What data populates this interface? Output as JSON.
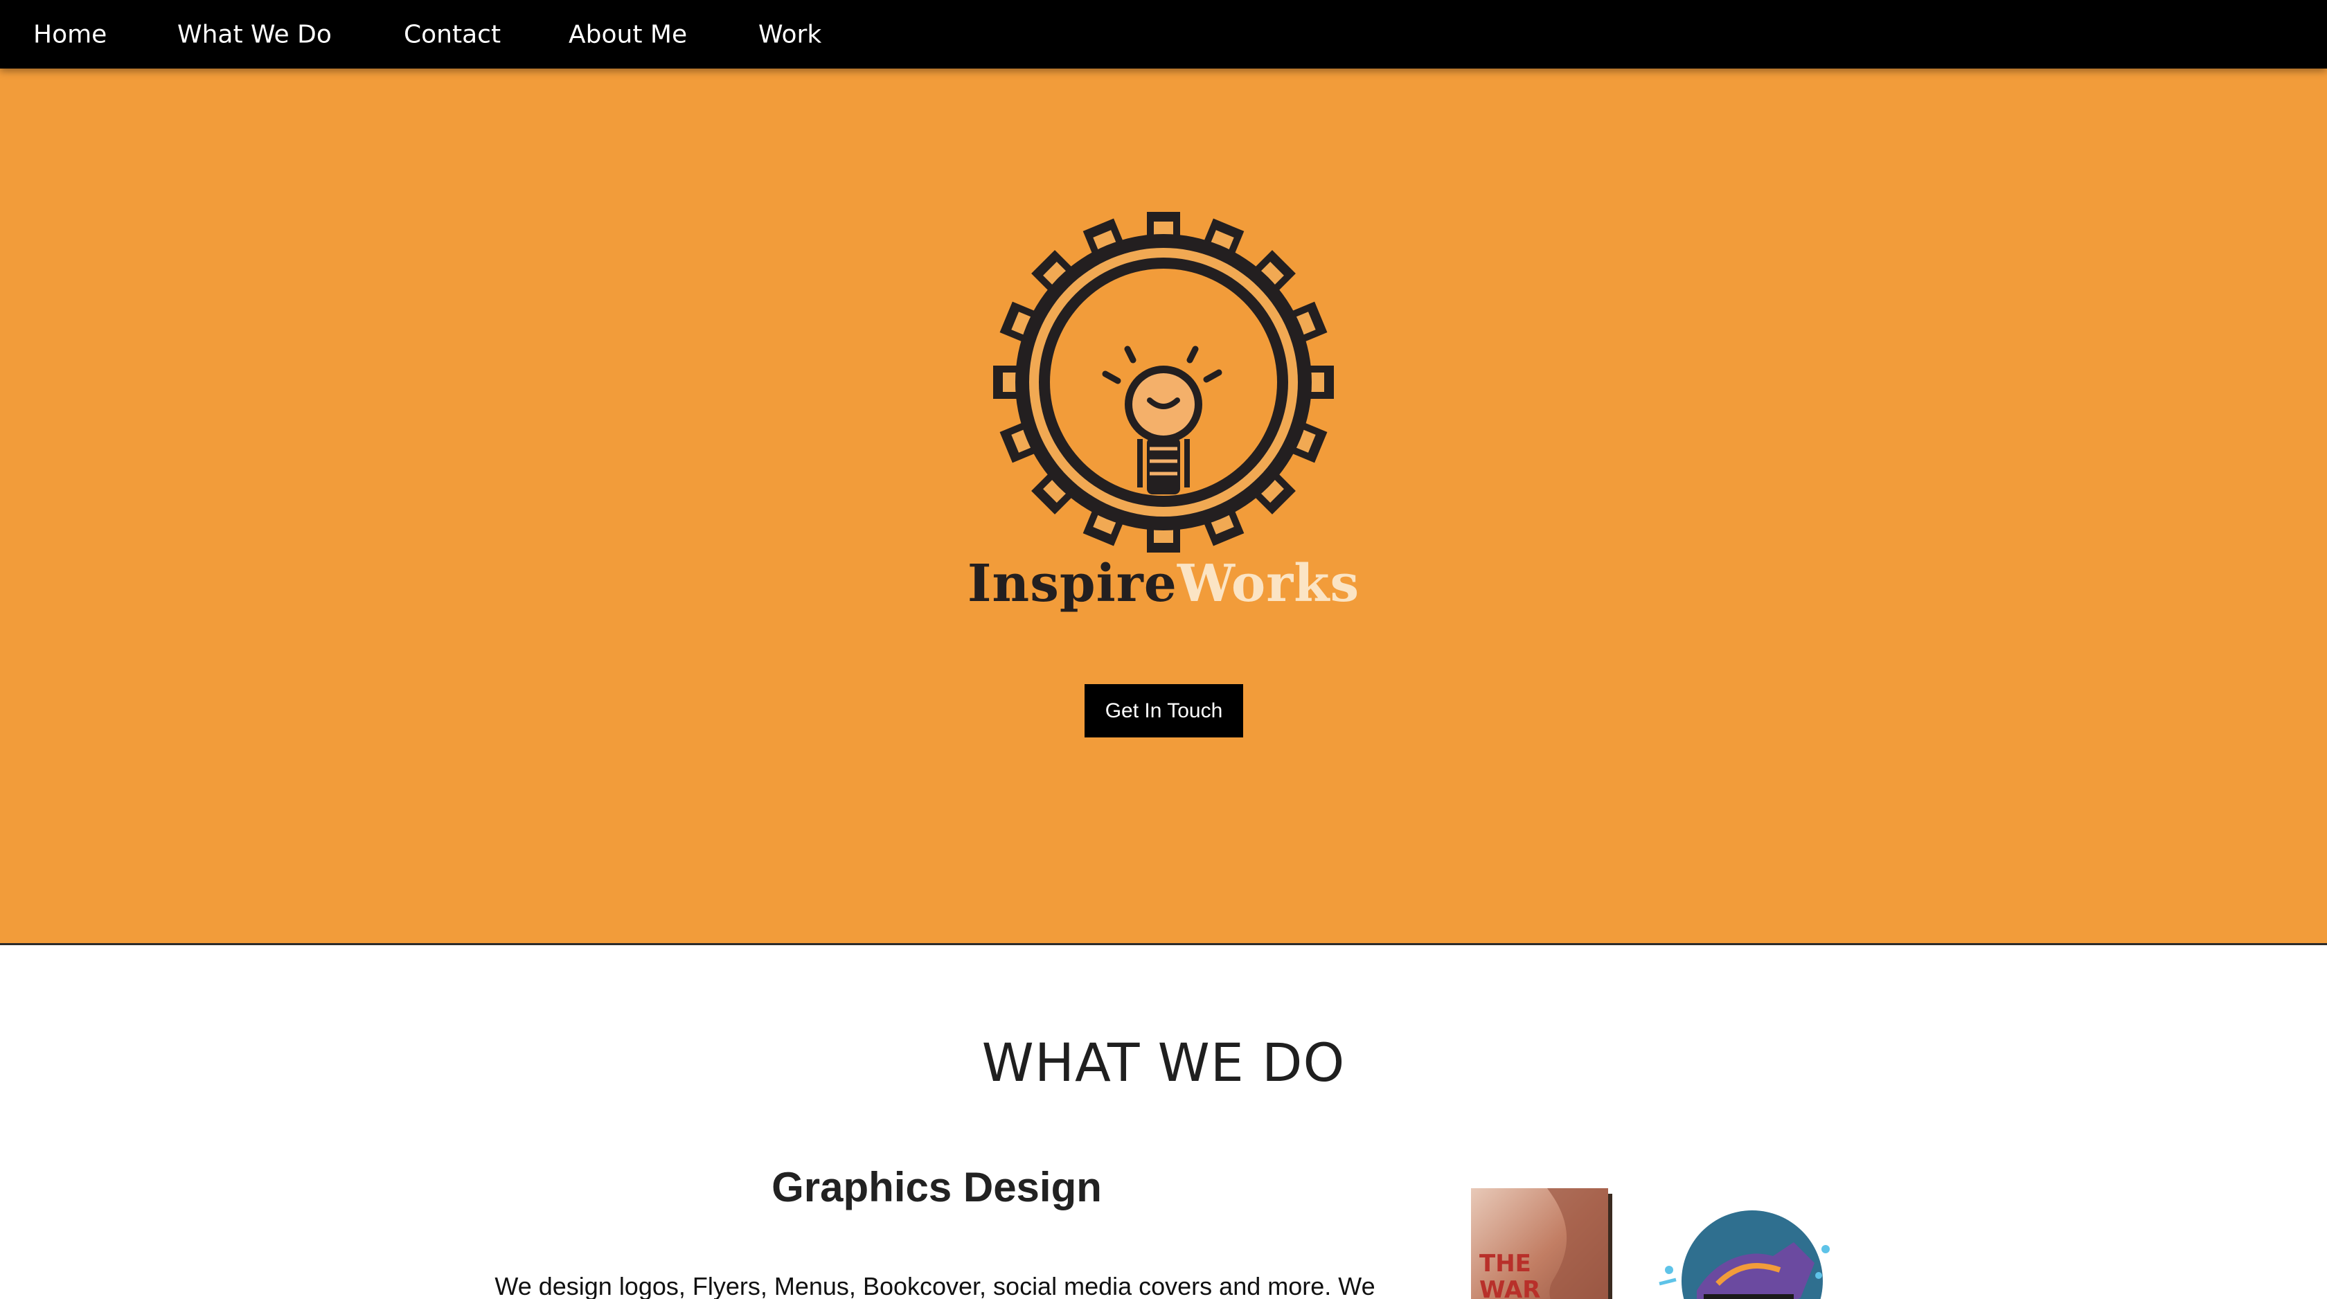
{
  "nav": {
    "items": [
      "Home",
      "What We Do",
      "Contact",
      "About Me",
      "Work"
    ]
  },
  "hero": {
    "brand_part1": "Inspire",
    "brand_part2": "Works",
    "cta_label": "Get In Touch"
  },
  "what_we_do": {
    "title": "WHAT WE DO",
    "service_title": "Graphics Design",
    "service_text": "We design logos, Flyers, Menus, Bookcover, social media covers and more. We",
    "book_title_line1": "THE",
    "book_title_line2": "WAR"
  },
  "colors": {
    "nav_bg": "#000000",
    "hero_bg": "#f29c3a",
    "logo_dark": "#231f20",
    "logo_fill": "#f1a953",
    "brand_light": "#fbe4c4",
    "button_bg": "#000000"
  },
  "icons": {
    "logo": "gear-lightbulb-icon",
    "book": "book-cover-image",
    "badge": "sneaker-badge-image"
  }
}
